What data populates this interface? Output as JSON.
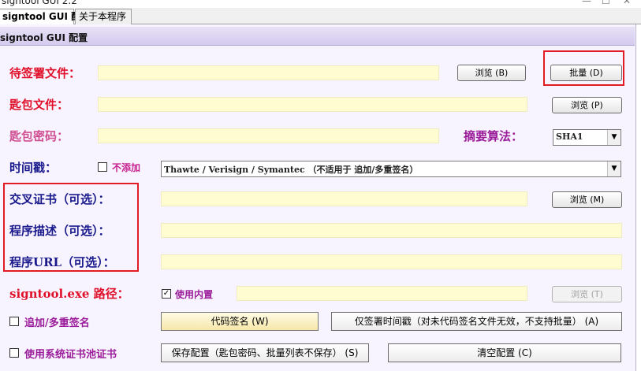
{
  "window": {
    "title": "signtool GUI 2.2",
    "controls": [
      "—",
      "☐",
      "✕"
    ]
  },
  "tabs": [
    {
      "label": "signtool GUI 配置",
      "active": true
    },
    {
      "label": "关于本程序",
      "active": false
    }
  ],
  "group": {
    "title": "signtool GUI 配置"
  },
  "labels": {
    "file_to_sign": "待签署文件：",
    "key_file": "匙包文件：",
    "key_password": "匙包密码：",
    "digest_algo": "摘要算法：",
    "timestamp": "时间戳：",
    "cross_cert": "交叉证书（可选）：",
    "description": "程序描述（可选）：",
    "url": "程序URL（可选）：",
    "signtool_path": "signtool.exe 路径："
  },
  "buttons": {
    "browse_b": "浏览 (B)",
    "batch_d": "批量 (D)",
    "browse_p": "浏览 (P)",
    "browse_m": "浏览 (M)",
    "browse_t": "浏览 (T)",
    "code_sign": "代码签名 (W)",
    "timestamp_only": "仅签署时间戳（对未代码签名文件无效，不支持批量） (A)",
    "save_config": "保存配置（匙包密码、批量列表不保存） (S)",
    "clear_config": "清空配置 (C)"
  },
  "checkboxes": {
    "no_timestamp": {
      "label": "不添加",
      "checked": false
    },
    "use_builtin": {
      "label": "使用内置",
      "checked": true
    },
    "append_sign": {
      "label": "追加/多重签名",
      "checked": false
    },
    "use_system_store": {
      "label": "使用系统证书池证书",
      "checked": false
    }
  },
  "selects": {
    "digest": {
      "value": "SHA1"
    },
    "timestamp_server": {
      "value": "Thawte / Verisign / Symantec   （不适用于 追加/多重签名）"
    }
  },
  "colors": {
    "panel_bg": "#f8f4ff",
    "field_bg": "#fffcd2",
    "highlight_red": "#e31b23"
  }
}
